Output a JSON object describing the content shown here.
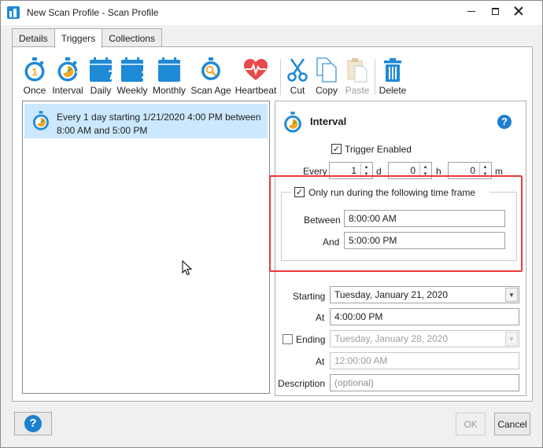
{
  "window": {
    "title": "New Scan Profile - Scan Profile"
  },
  "tabs": [
    {
      "label": "Details"
    },
    {
      "label": "Triggers"
    },
    {
      "label": "Collections"
    }
  ],
  "toolbar": {
    "once": "Once",
    "interval": "Interval",
    "daily": "Daily",
    "daily_icon_text": "1",
    "weekly": "Weekly",
    "weekly_icon_text": "7",
    "monthly": "Monthly",
    "monthly_icon_text": "31",
    "scan_age": "Scan Age",
    "heartbeat": "Heartbeat",
    "cut": "Cut",
    "copy": "Copy",
    "paste": "Paste",
    "delete": "Delete"
  },
  "trigger_list": [
    {
      "text": "Every 1 day starting 1/21/2020 4:00 PM between 8:00 AM and 5:00 PM"
    }
  ],
  "interval_panel": {
    "title": "Interval",
    "trigger_enabled_label": "Trigger Enabled",
    "trigger_enabled_checked": true,
    "every_label": "Every",
    "every_days": "1",
    "days_unit": "d",
    "every_hours": "0",
    "hours_unit": "h",
    "every_minutes": "0",
    "minutes_unit": "m",
    "time_frame_label": "Only run during the following time frame",
    "time_frame_checked": true,
    "between_label": "Between",
    "between_value": "8:00:00 AM",
    "and_label": "And",
    "and_value": "5:00:00 PM",
    "starting_label": "Starting",
    "starting_value": "Tuesday, January 21, 2020",
    "at_label": "At",
    "at_value": "4:00:00 PM",
    "ending_label": "Ending",
    "ending_checked": false,
    "ending_value": "Tuesday, January 28, 2020",
    "end_at_label": "At",
    "end_at_value": "12:00:00 AM",
    "description_label": "Description",
    "description_placeholder": "(optional)"
  },
  "footer": {
    "ok_label": "OK",
    "cancel_label": "Cancel"
  },
  "colors": {
    "accent_blue": "#1f8ad6",
    "highlight_red": "#e8393d",
    "selection": "#cce8ff",
    "heart_red": "#e84a4a",
    "stopwatch_orange": "#f5a623"
  }
}
